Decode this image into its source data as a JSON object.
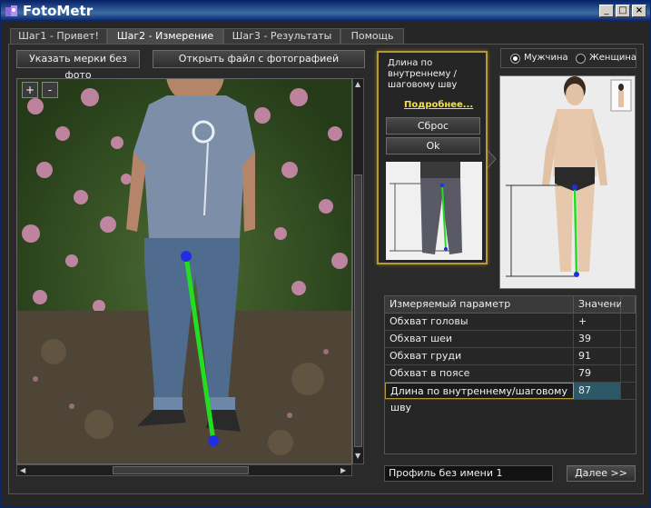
{
  "window": {
    "title": "FotoMetr"
  },
  "tabs": [
    {
      "label": "Шаг1 - Привет!"
    },
    {
      "label": "Шаг2 - Измерение"
    },
    {
      "label": "Шаг3 - Результаты"
    },
    {
      "label": "Помощь"
    }
  ],
  "toolbar": {
    "no_photo_button": "Указать мерки без фото",
    "open_file_button": "Открыть файл с фотографией"
  },
  "zoom": {
    "plus": "+",
    "minus": "-"
  },
  "tip": {
    "title": "Длина по внутреннему / шаговому шву",
    "more_link": "Подробнее...",
    "reset_button": "Сброс",
    "ok_button": "Ok"
  },
  "gender": {
    "male": "Мужчина",
    "female": "Женщина",
    "selected": "male"
  },
  "table": {
    "headers": [
      "Измеряемый параметр",
      "Значение"
    ],
    "rows": [
      {
        "param": "Обхват головы",
        "value": "+"
      },
      {
        "param": "Обхват шеи",
        "value": "39"
      },
      {
        "param": "Обхват груди",
        "value": "91"
      },
      {
        "param": "Обхват в поясе",
        "value": "79"
      },
      {
        "param": "Длина по внутреннему/шаговому шву",
        "value": "87"
      }
    ],
    "selected_row": 4
  },
  "profile": {
    "name": "Профиль без имени 1"
  },
  "next_button": "Далее >>",
  "colors": {
    "accent_border": "#b59a3a",
    "measure_line": "#22dd22",
    "measure_point": "#1f2fe0",
    "link": "#f4e040"
  }
}
